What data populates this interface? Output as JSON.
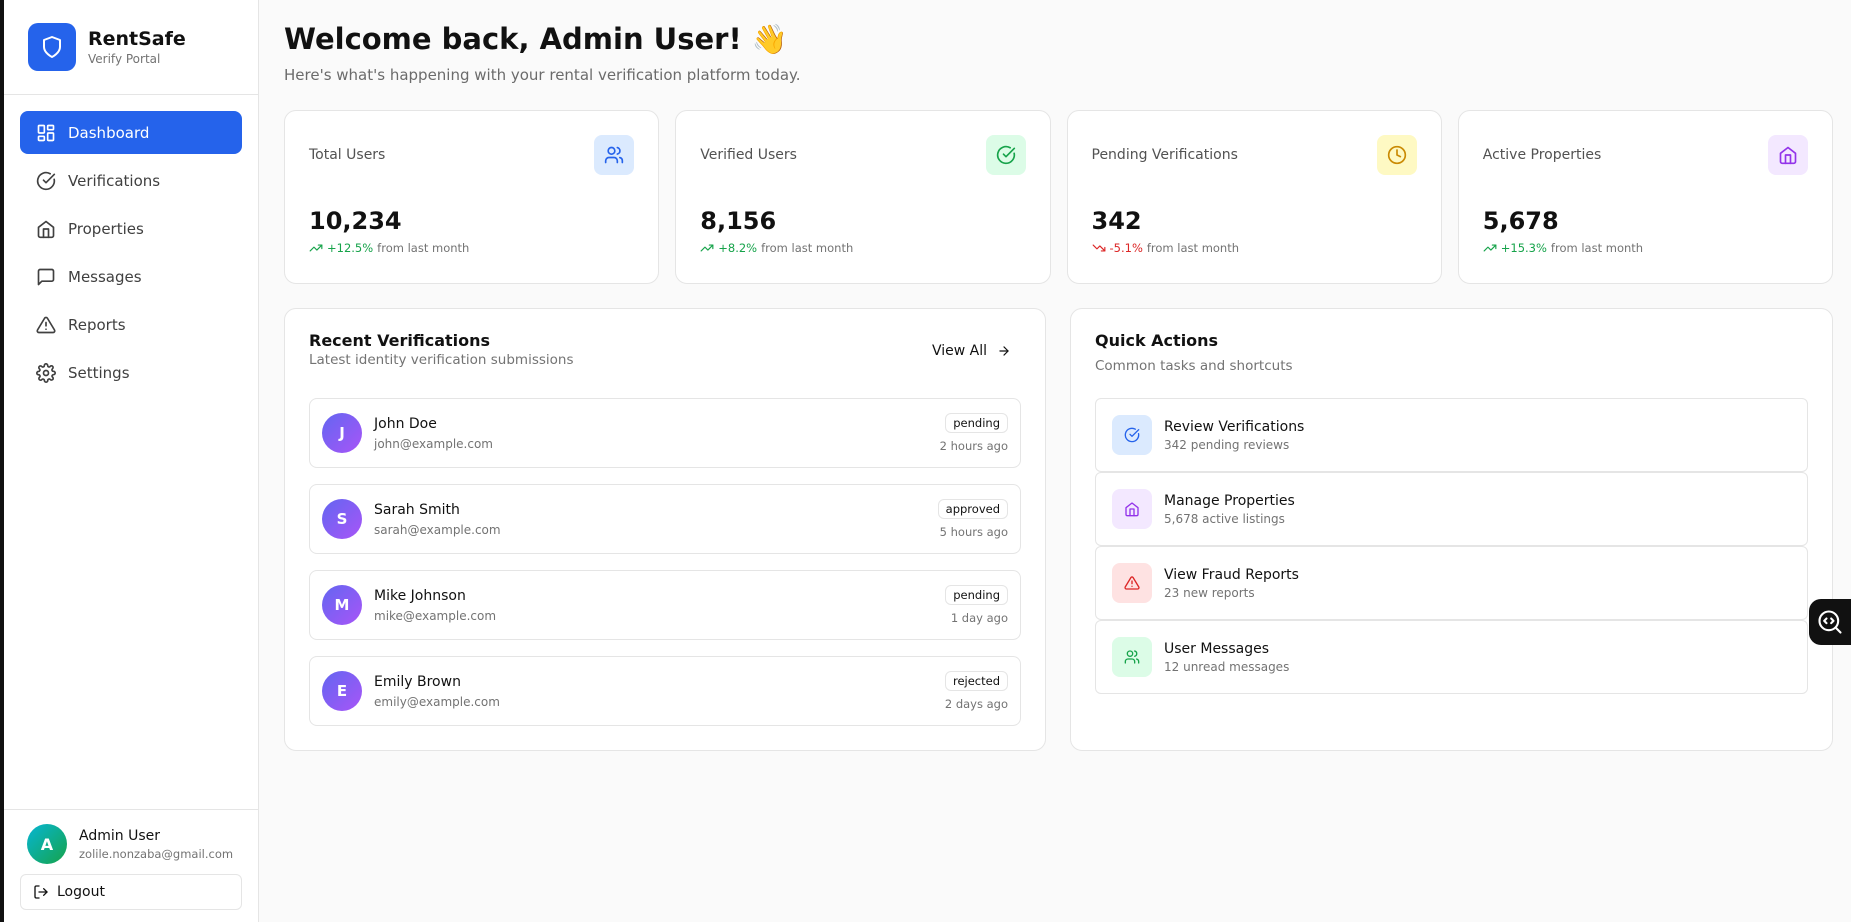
{
  "brand": {
    "name": "RentSafe",
    "subtitle": "Verify Portal",
    "color": "#2563eb"
  },
  "nav": [
    {
      "label": "Dashboard",
      "icon": "dashboard-icon",
      "active": true
    },
    {
      "label": "Verifications",
      "icon": "check-circle-icon"
    },
    {
      "label": "Properties",
      "icon": "home-icon"
    },
    {
      "label": "Messages",
      "icon": "message-icon"
    },
    {
      "label": "Reports",
      "icon": "alert-triangle-icon"
    },
    {
      "label": "Settings",
      "icon": "gear-icon"
    }
  ],
  "user": {
    "initial": "A",
    "name": "Admin User",
    "email": "zolile.nonzaba@gmail.com",
    "logout_label": "Logout"
  },
  "header": {
    "title": "Welcome back, Admin User! 👋",
    "subtitle": "Here's what's happening with your rental verification platform today."
  },
  "stats": [
    {
      "label": "Total Users",
      "value": "10,234",
      "trend": "+12.5%",
      "trend_dir": "up",
      "trend_note": "from last month",
      "icon": "users-icon",
      "icon_bg": "#dbeafe",
      "icon_color": "#2563eb"
    },
    {
      "label": "Verified Users",
      "value": "8,156",
      "trend": "+8.2%",
      "trend_dir": "up",
      "trend_note": "from last month",
      "icon": "check-circle-icon",
      "icon_bg": "#dcfce7",
      "icon_color": "#16a34a"
    },
    {
      "label": "Pending Verifications",
      "value": "342",
      "trend": "-5.1%",
      "trend_dir": "down",
      "trend_note": "from last month",
      "icon": "clock-icon",
      "icon_bg": "#fef9c3",
      "icon_color": "#ca8a04"
    },
    {
      "label": "Active Properties",
      "value": "5,678",
      "trend": "+15.3%",
      "trend_dir": "up",
      "trend_note": "from last month",
      "icon": "home-icon",
      "icon_bg": "#f3e8ff",
      "icon_color": "#9333ea"
    }
  ],
  "recent": {
    "title": "Recent Verifications",
    "subtitle": "Latest identity verification submissions",
    "view_all": "View All",
    "items": [
      {
        "initial": "J",
        "name": "John Doe",
        "email": "john@example.com",
        "status": "pending",
        "time": "2 hours ago"
      },
      {
        "initial": "S",
        "name": "Sarah Smith",
        "email": "sarah@example.com",
        "status": "approved",
        "time": "5 hours ago"
      },
      {
        "initial": "M",
        "name": "Mike Johnson",
        "email": "mike@example.com",
        "status": "pending",
        "time": "1 day ago"
      },
      {
        "initial": "E",
        "name": "Emily Brown",
        "email": "emily@example.com",
        "status": "rejected",
        "time": "2 days ago"
      }
    ]
  },
  "quick": {
    "title": "Quick Actions",
    "subtitle": "Common tasks and shortcuts",
    "items": [
      {
        "title": "Review Verifications",
        "sub": "342 pending reviews",
        "icon": "check-circle-icon",
        "bg": "#dbeafe",
        "color": "#2563eb"
      },
      {
        "title": "Manage Properties",
        "sub": "5,678 active listings",
        "icon": "home-icon",
        "bg": "#f3e8ff",
        "color": "#9333ea"
      },
      {
        "title": "View Fraud Reports",
        "sub": "23 new reports",
        "icon": "alert-triangle-icon",
        "bg": "#fee2e2",
        "color": "#dc2626"
      },
      {
        "title": "User Messages",
        "sub": "12 unread messages",
        "icon": "users-icon",
        "bg": "#dcfce7",
        "color": "#16a34a"
      }
    ]
  }
}
